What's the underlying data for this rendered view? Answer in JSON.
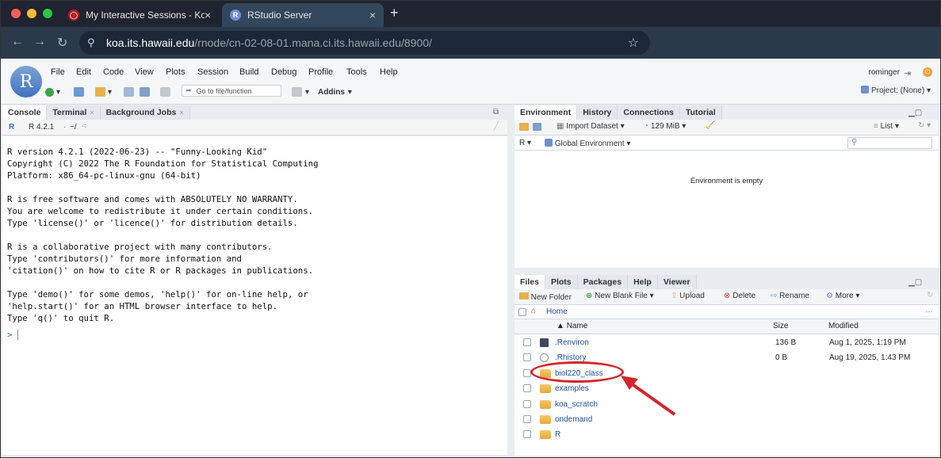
{
  "browser": {
    "tabs": [
      {
        "label": "My Interactive Sessions - Koa",
        "icon": "ondemand-icon"
      },
      {
        "label": "RStudio Server",
        "icon": "rstudio-icon"
      }
    ],
    "url_host": "koa.its.hawaii.edu",
    "url_path": "/rnode/cn-02-08-01.mana.ci.its.hawaii.edu/8900/"
  },
  "menubar": [
    "File",
    "Edit",
    "Code",
    "View",
    "Plots",
    "Session",
    "Build",
    "Debug",
    "Profile",
    "Tools",
    "Help"
  ],
  "toolbar": {
    "goto_placeholder": "Go to file/function",
    "addins": "Addins",
    "user": "rominger",
    "project": "Project: (None)"
  },
  "left_pane": {
    "tabs": [
      "Console",
      "Terminal",
      "Background Jobs"
    ],
    "r_version_label": "R 4.2.1",
    "working_dir": "~/",
    "console_lines": [
      "R version 4.2.1 (2022-06-23) -- \"Funny-Looking Kid\"",
      "Copyright (C) 2022 The R Foundation for Statistical Computing",
      "Platform: x86_64-pc-linux-gnu (64-bit)",
      "",
      "R is free software and comes with ABSOLUTELY NO WARRANTY.",
      "You are welcome to redistribute it under certain conditions.",
      "Type 'license()' or 'licence()' for distribution details.",
      "",
      "R is a collaborative project with many contributors.",
      "Type 'contributors()' for more information and",
      "'citation()' on how to cite R or R packages in publications.",
      "",
      "Type 'demo()' for some demos, 'help()' for on-line help, or",
      "'help.start()' for an HTML browser interface to help.",
      "Type 'q()' to quit R."
    ],
    "prompt": ">"
  },
  "env_pane": {
    "tabs": [
      "Environment",
      "History",
      "Connections",
      "Tutorial"
    ],
    "import_dataset": "Import Dataset",
    "memory": "129 MiB",
    "list_label": "List",
    "r_label": "R",
    "global_env": "Global Environment",
    "empty_message": "Environment is empty"
  },
  "files_pane": {
    "tabs": [
      "Files",
      "Plots",
      "Packages",
      "Help",
      "Viewer"
    ],
    "actions": {
      "new_folder": "New Folder",
      "new_blank_file": "New Blank File",
      "upload": "Upload",
      "delete": "Delete",
      "rename": "Rename",
      "more": "More"
    },
    "breadcrumb": "Home",
    "columns": {
      "name": "Name",
      "size": "Size",
      "modified": "Modified"
    },
    "rows": [
      {
        "name": ".Renviron",
        "size": "136 B",
        "modified": "Aug 1, 2025, 1:19 PM",
        "icon": "text-file-icon"
      },
      {
        "name": ".Rhistory",
        "size": "0 B",
        "modified": "Aug 19, 2025, 1:43 PM",
        "icon": "history-file-icon"
      },
      {
        "name": "biol220_class",
        "size": "",
        "modified": "",
        "icon": "folder-icon"
      },
      {
        "name": "examples",
        "size": "",
        "modified": "",
        "icon": "folder-icon"
      },
      {
        "name": "koa_scratch",
        "size": "",
        "modified": "",
        "icon": "folder-icon"
      },
      {
        "name": "ondemand",
        "size": "",
        "modified": "",
        "icon": "folder-icon"
      },
      {
        "name": "R",
        "size": "",
        "modified": "",
        "icon": "folder-icon"
      }
    ]
  },
  "annotation": {
    "color": "#d5262b"
  }
}
